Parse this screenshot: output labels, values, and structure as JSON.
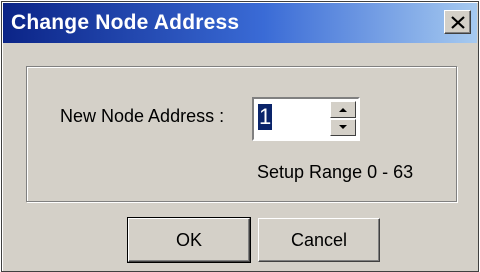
{
  "dialog": {
    "title": "Change Node Address",
    "close_glyph": "close-icon"
  },
  "form": {
    "node_address_label": "New Node Address :",
    "node_address_value": "1",
    "range_text": "Setup Range 0 - 63"
  },
  "buttons": {
    "ok_label": "OK",
    "cancel_label": "Cancel"
  },
  "colors": {
    "titlebar_start": "#0b2487",
    "titlebar_end": "#a6caf0",
    "face": "#d4d0c8",
    "selection": "#0a246a"
  }
}
